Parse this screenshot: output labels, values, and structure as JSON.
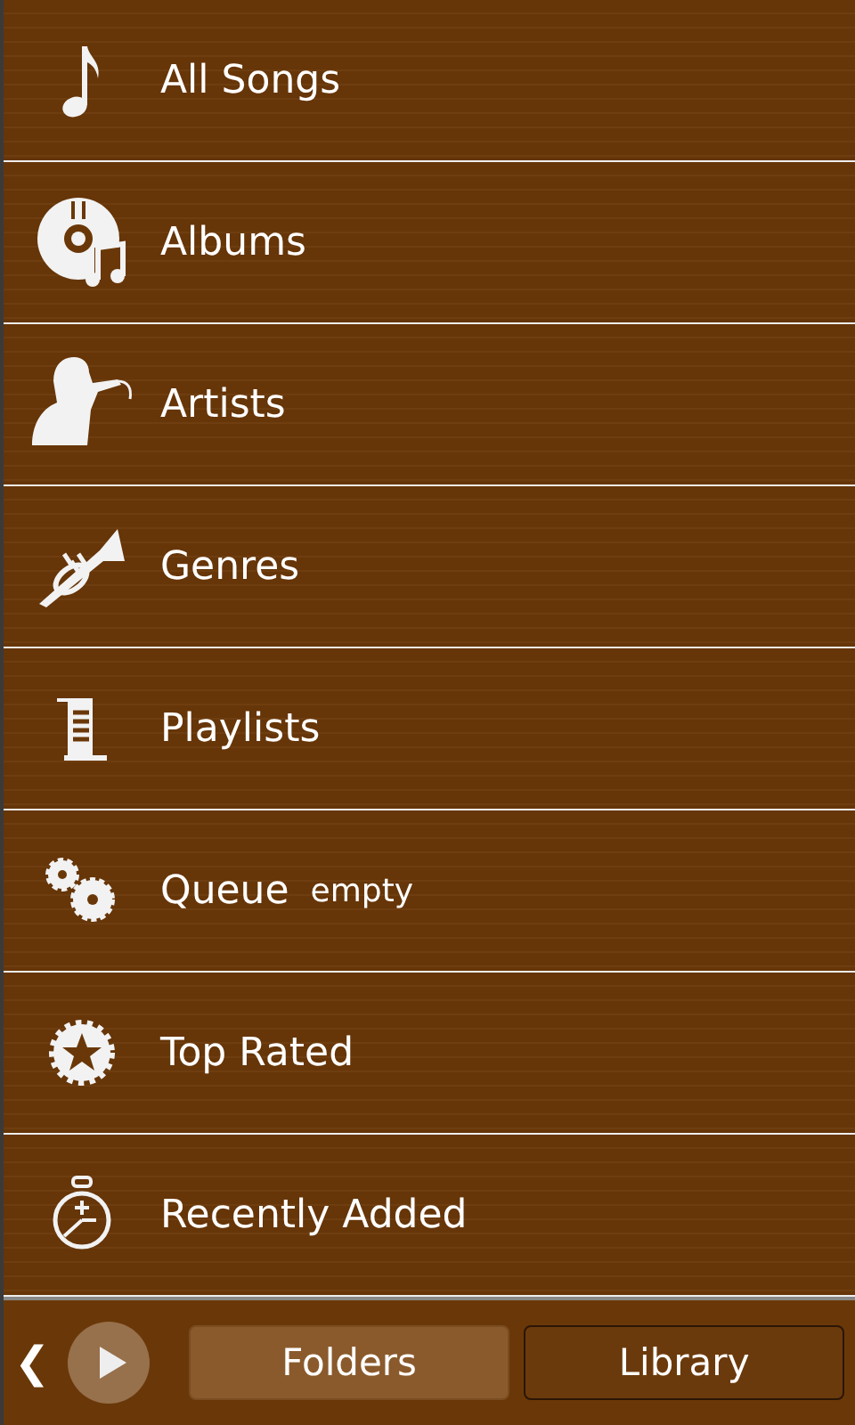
{
  "menu": [
    {
      "label": "All Songs"
    },
    {
      "label": "Albums"
    },
    {
      "label": "Artists"
    },
    {
      "label": "Genres"
    },
    {
      "label": "Playlists"
    },
    {
      "label": "Queue",
      "note": "empty"
    },
    {
      "label": "Top Rated"
    },
    {
      "label": "Recently Added"
    }
  ],
  "bottom_bar": {
    "back": "❮",
    "tabs": [
      {
        "label": "Folders",
        "selected": false
      },
      {
        "label": "Library",
        "selected": true
      }
    ]
  }
}
